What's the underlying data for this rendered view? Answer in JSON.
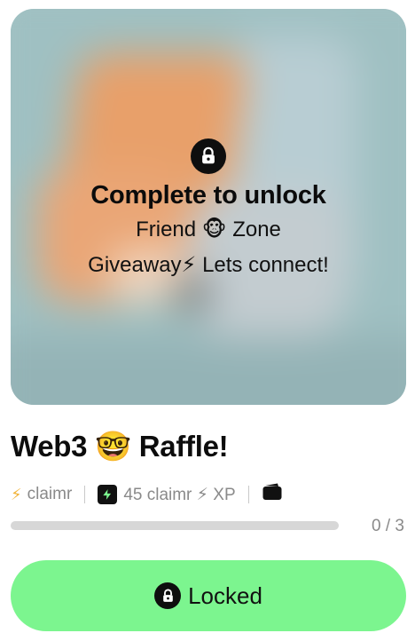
{
  "card": {
    "locked_overlay": {
      "title": "Complete to unlock",
      "line1": "Friend 🐵 Zone",
      "line2": "Giveaway⚡ Lets connect!",
      "icon": "lock-icon"
    },
    "title": "Web3 🤓 Raffle!",
    "meta": {
      "creator": "claimr",
      "xp_label": "45 claimr ⚡ XP",
      "icons": [
        "bolt-icon",
        "xp-bolt-icon",
        "wallet-icon"
      ]
    },
    "progress": {
      "current": 0,
      "total": 3,
      "text": "0 / 3"
    },
    "cta": {
      "label": "Locked",
      "icon": "lock-icon"
    }
  },
  "colors": {
    "cta_green": "#7cf58f",
    "bolt_yellow": "#f2b43a",
    "muted_text": "#8a8a8a"
  }
}
